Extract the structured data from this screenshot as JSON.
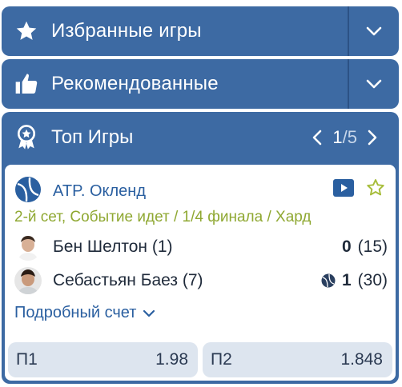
{
  "favorites": {
    "label": "Избранные игры",
    "icon": "star-icon"
  },
  "recommended": {
    "label": "Рекомендованные",
    "icon": "thumbs-up-icon"
  },
  "top_games": {
    "label": "Топ Игры",
    "icon": "award-ribbon-icon",
    "pager": {
      "current": "1",
      "separator": "/",
      "total": "5"
    }
  },
  "match": {
    "league": "ATP. Окленд",
    "status": "2-й сет, Событие идет / 1/4 финала / Хард",
    "players": [
      {
        "name": "Бен Шелтон (1)",
        "sets": "0",
        "games": "(15)",
        "serving": false
      },
      {
        "name": "Себастьян Баез (7)",
        "sets": "1",
        "games": "(30)",
        "serving": true
      }
    ],
    "details_link": "Подробный счет",
    "odds": [
      {
        "label": "П1",
        "value": "1.98"
      },
      {
        "label": "П2",
        "value": "1.848"
      }
    ]
  },
  "colors": {
    "header_blue": "#3d6aa3",
    "link_blue": "#2a5fa0",
    "status_green": "#8fa832",
    "odds_bg": "#dde5ef"
  }
}
